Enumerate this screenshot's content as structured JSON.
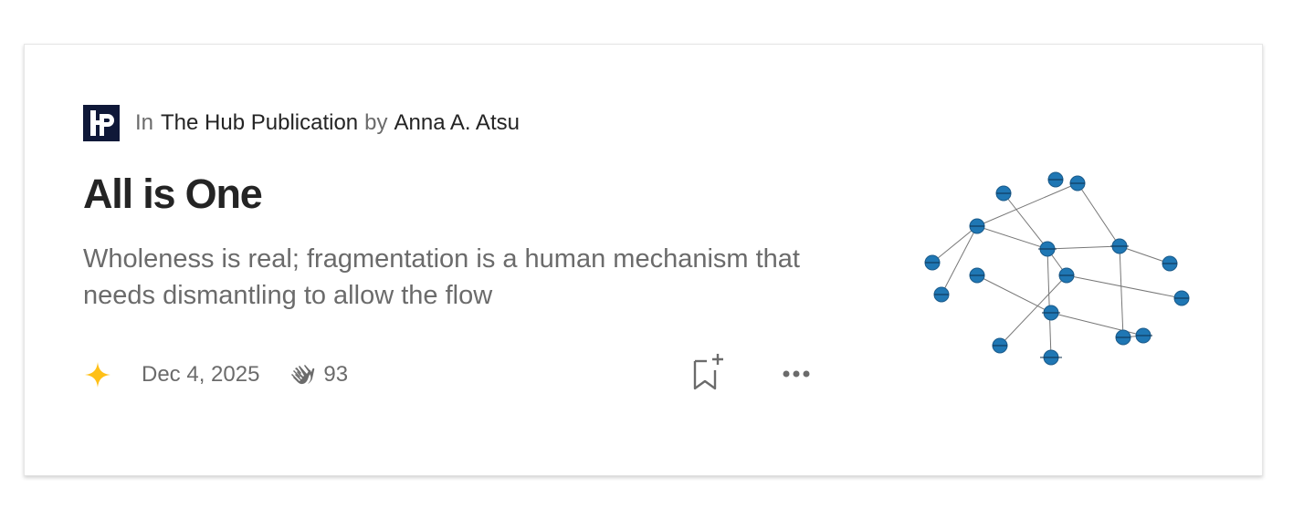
{
  "publication": {
    "prefix": "In",
    "name": "The Hub Publication",
    "by_word": "by",
    "author": "Anna A. Atsu",
    "logo_icon": "hub-publication-logo",
    "logo_color": "#0f1838"
  },
  "article": {
    "title": "All is One",
    "subtitle": "Wholeness is real; fragmentation is a human mechanism that needs dismantling to allow the flow"
  },
  "meta": {
    "member_icon": "sparkle-icon",
    "member_color": "#ffc017",
    "date": "Dec 4, 2025",
    "clap_icon": "clap-icon",
    "claps": "93"
  },
  "actions": {
    "save_icon": "bookmark-plus-icon",
    "more_icon": "more-horizontal-icon"
  },
  "thumbnail": {
    "description_icon": "network-graph",
    "node_color": "#1f77b4"
  }
}
